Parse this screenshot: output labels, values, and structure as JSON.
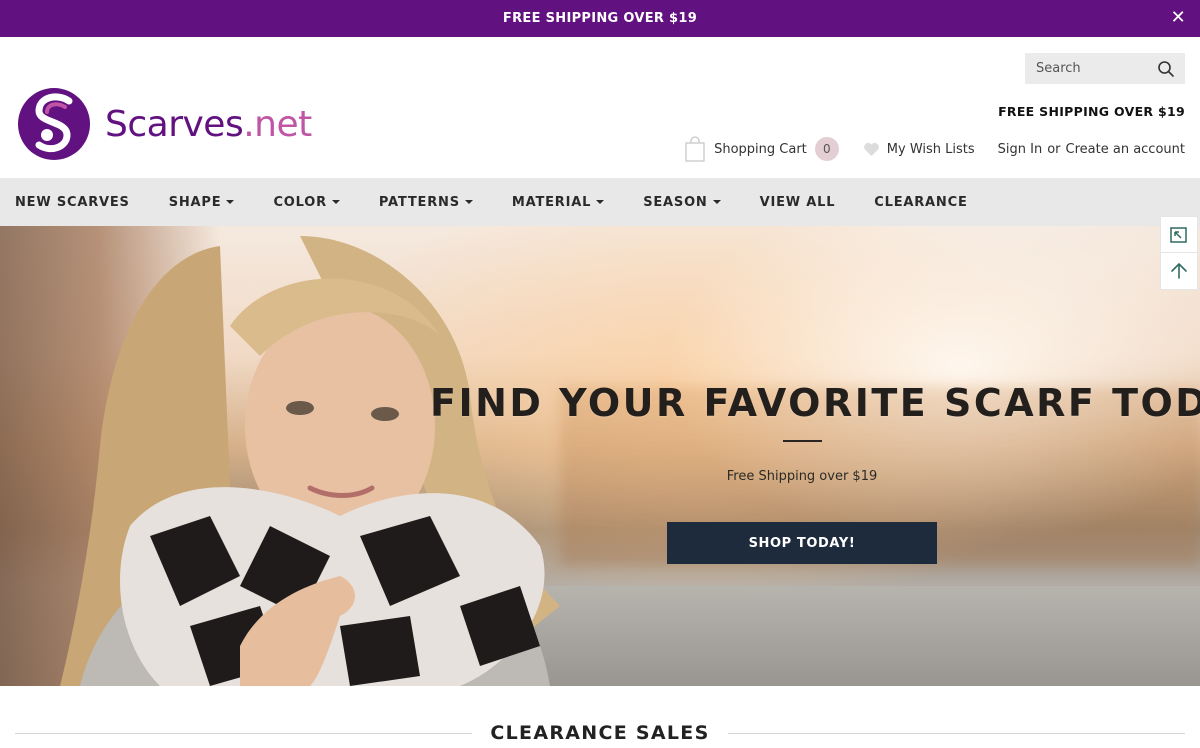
{
  "announcement": {
    "text": "FREE SHIPPING OVER $19",
    "close_icon": "close-icon"
  },
  "header": {
    "logo": {
      "brand": "Scarves",
      "tld": ".net"
    },
    "search": {
      "placeholder": "Search",
      "icon": "search-icon"
    },
    "shipping_text": "FREE SHIPPING OVER $19",
    "cart": {
      "label": "Shopping Cart",
      "count": "0",
      "icon": "shopping-bag-icon"
    },
    "wishlist": {
      "label": "My Wish Lists",
      "icon": "heart-icon"
    },
    "account": {
      "sign_in": "Sign In",
      "separator": "or",
      "create": "Create an account"
    }
  },
  "nav": {
    "items": [
      {
        "label": "NEW SCARVES",
        "dropdown": false
      },
      {
        "label": "SHAPE",
        "dropdown": true
      },
      {
        "label": "COLOR",
        "dropdown": true
      },
      {
        "label": "PATTERNS",
        "dropdown": true
      },
      {
        "label": "MATERIAL",
        "dropdown": true
      },
      {
        "label": "SEASON",
        "dropdown": true
      },
      {
        "label": "VIEW ALL",
        "dropdown": false
      },
      {
        "label": "CLEARANCE",
        "dropdown": false
      }
    ]
  },
  "hero": {
    "title": "FIND YOUR FAVORITE SCARF TODAY!",
    "subtitle": "Free Shipping over $19",
    "button": "SHOP TODAY!"
  },
  "side_tools": [
    {
      "icon": "compare-icon"
    },
    {
      "icon": "arrow-up-icon"
    }
  ],
  "section": {
    "title": "CLEARANCE SALES"
  },
  "colors": {
    "brand_purple": "#621180",
    "brand_pink": "#c055a5",
    "button_navy": "#1d2b3d",
    "nav_bg": "#e8e8e8"
  }
}
